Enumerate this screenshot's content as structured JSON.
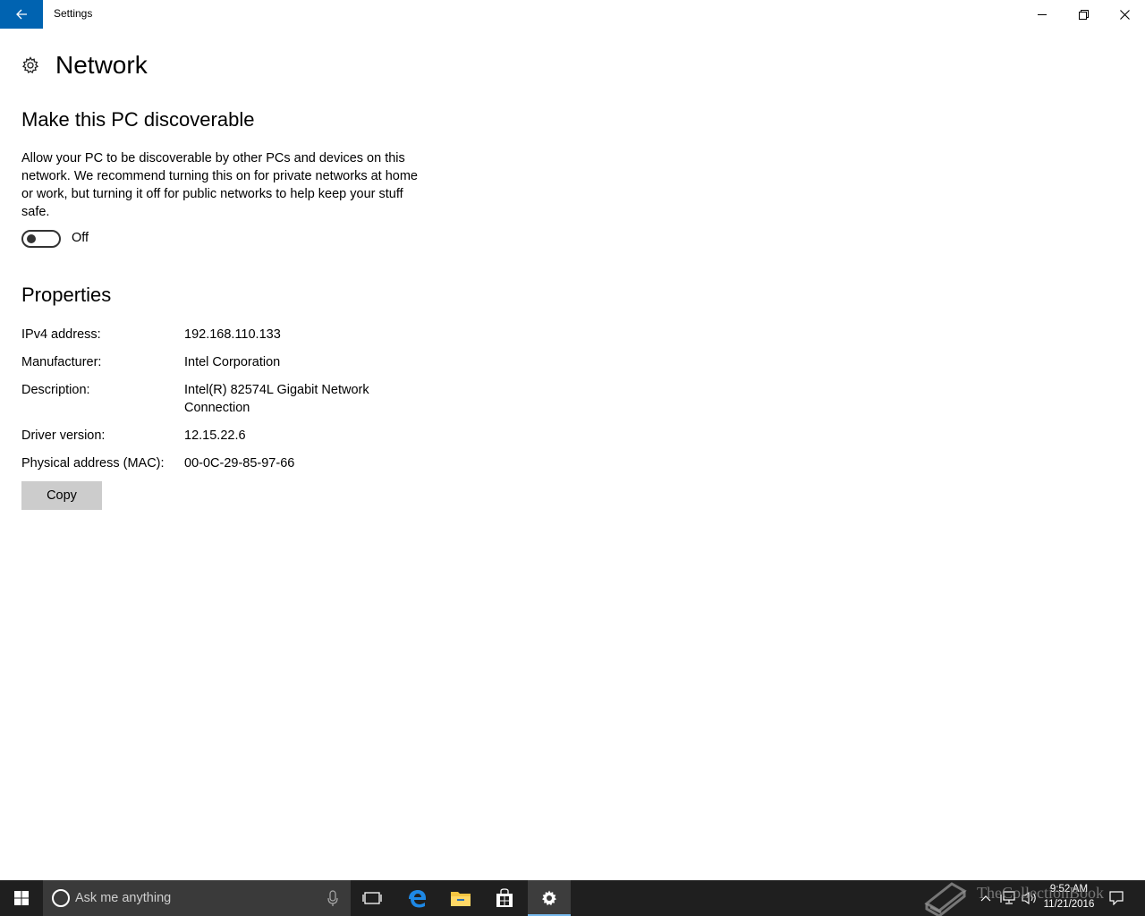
{
  "window": {
    "title": "Settings"
  },
  "page": {
    "title": "Network",
    "icon": "gear-icon"
  },
  "discover": {
    "heading": "Make this PC discoverable",
    "description": "Allow your PC to be discoverable by other PCs and devices on this network. We recommend turning this on for private networks at home or work, but turning it off for public networks to help keep your stuff safe.",
    "toggle_state": "Off",
    "toggle_on": false
  },
  "properties": {
    "heading": "Properties",
    "items": [
      {
        "label": "IPv4 address:",
        "value": "192.168.110.133"
      },
      {
        "label": "Manufacturer:",
        "value": "Intel Corporation"
      },
      {
        "label": "Description:",
        "value": "Intel(R) 82574L Gigabit Network Connection"
      },
      {
        "label": "Driver version:",
        "value": "12.15.22.6"
      },
      {
        "label": "Physical address (MAC):",
        "value": "00-0C-29-85-97-66"
      }
    ],
    "copy_label": "Copy"
  },
  "taskbar": {
    "search_placeholder": "Ask me anything",
    "time": "9:52 AM",
    "date": "11/21/2016",
    "pinned": [
      "task-view-icon",
      "edge-icon",
      "file-explorer-icon",
      "store-icon",
      "settings-icon"
    ]
  },
  "watermark": {
    "text": "TheCollectionBook"
  },
  "colors": {
    "accent": "#0063b1",
    "taskbar": "#1f1f1f",
    "button_bg": "#cccccc"
  }
}
